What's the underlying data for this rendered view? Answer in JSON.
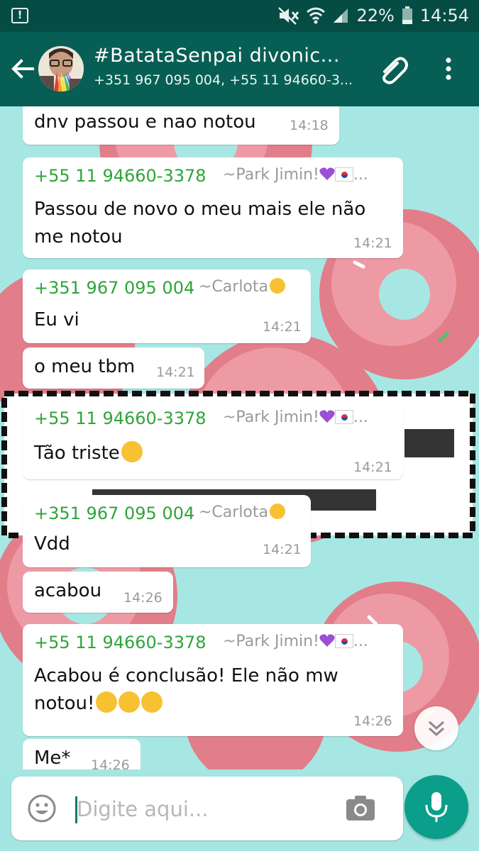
{
  "status_bar": {
    "battery": "22%",
    "time": "14:54",
    "alert_glyph": "!"
  },
  "header": {
    "title": "#BatataSenpai divonic...",
    "subtitle": "+351 967 095 004, +55 11 94660-3...",
    "accent": "#075e54"
  },
  "messages": [
    {
      "text": "dnv passou e nao notou",
      "time": "14:18"
    },
    {
      "sender": "+55 11 94660-3378",
      "alias": "~Park Jimin!",
      "text_lines": [
        "Passou de novo o meu mais ele não",
        "me notou"
      ],
      "time": "14:21"
    },
    {
      "sender": "+351 967 095 004",
      "alias": "~Carlota",
      "text": "Eu vi",
      "time": "14:21"
    },
    {
      "text": "o meu tbm",
      "time": "14:21"
    },
    {
      "sender": "+55 11 94660-3378",
      "alias": "~Park Jimin!",
      "text": "Tão triste",
      "time": "14:21"
    },
    {
      "sender": "+351 967 095 004",
      "alias": "~Carlota",
      "text": "Vdd",
      "time": "14:21"
    },
    {
      "text": "acabou",
      "time": "14:26"
    },
    {
      "sender": "+55 11 94660-3378",
      "alias": "~Park Jimin!",
      "text_lines": [
        "Acabou é conclusão! Ele não mw",
        "notou!"
      ],
      "time": "14:26"
    },
    {
      "text": "Me*",
      "time": "14:26"
    }
  ],
  "ellipsis": "...",
  "composer": {
    "placeholder": "Digite aqui..."
  },
  "colors": {
    "sender": "#2fa43a",
    "time": "#9a9a9a",
    "fab": "#0a9e8b"
  }
}
